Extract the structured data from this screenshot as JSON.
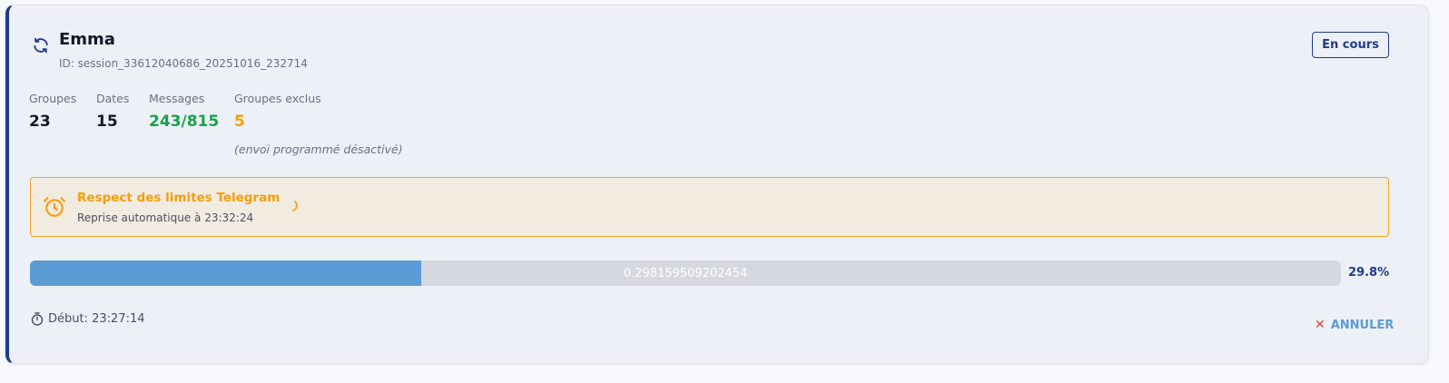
{
  "session": {
    "name": "Emma",
    "id_text": "ID: session_33612040686_20251016_232714",
    "status": "En cours"
  },
  "stats": {
    "groups_label": "Groupes",
    "groups_value": "23",
    "dates_label": "Dates",
    "dates_value": "15",
    "messages_label": "Messages",
    "messages_value": "243/815",
    "excluded_label": "Groupes exclus",
    "excluded_value": "5",
    "excluded_note": "(envoi programmé désactivé)"
  },
  "alert": {
    "title": "Respect des limites Telegram",
    "subtitle": "Reprise automatique à 23:32:24"
  },
  "progress": {
    "fraction": 0.298159509202454,
    "raw_text": "0.298159509202454",
    "percent_text": "29.8%"
  },
  "footer": {
    "start_text": "Début: 23:27:14",
    "cancel_label": "ANNULER"
  },
  "colors": {
    "accent": "#1e3a8a",
    "success": "#16a34a",
    "warning": "#f59e0b",
    "progress": "#5b9bd5",
    "danger": "#e0413b"
  }
}
